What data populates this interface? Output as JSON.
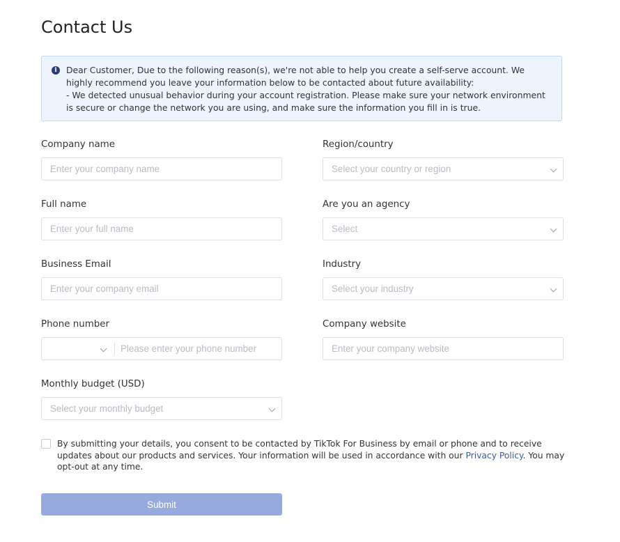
{
  "page": {
    "title": "Contact Us"
  },
  "notice": {
    "line1": "Dear Customer, Due to the following reason(s), we're not able to help you create a self-serve account. We highly recommend you leave your information below to be contacted about future availability:",
    "line2": "- We detected unusual behavior during your account registration. Please make sure your network environment is secure or change the network you are using, and make sure the information you fill in is true."
  },
  "form": {
    "company_name": {
      "label": "Company name",
      "placeholder": "Enter your company name",
      "value": ""
    },
    "region": {
      "label": "Region/country",
      "placeholder": "Select your country or region"
    },
    "full_name": {
      "label": "Full name",
      "placeholder": "Enter your full name",
      "value": ""
    },
    "agency": {
      "label": "Are you an agency",
      "placeholder": "Select"
    },
    "email": {
      "label": "Business Email",
      "placeholder": "Enter your company email",
      "value": ""
    },
    "industry": {
      "label": "Industry",
      "placeholder": "Select your industry"
    },
    "phone": {
      "label": "Phone number",
      "code": "",
      "placeholder": "Please enter your phone number",
      "value": ""
    },
    "website": {
      "label": "Company website",
      "placeholder": "Enter your company website",
      "value": ""
    },
    "budget": {
      "label": "Monthly budget (USD)",
      "placeholder": "Select your monthly budget"
    }
  },
  "consent": {
    "checked": false,
    "text_before": "By submitting your details, you consent to be contacted by TikTok For Business by email or phone and to receive updates about our products and services. Your information will be used in accordance with our ",
    "link": "Privacy Policy",
    "text_after": ". You may opt-out at any time."
  },
  "submit": {
    "label": "Submit"
  },
  "colors": {
    "accent": "#97aadd",
    "link": "#3c5aa8",
    "notice_bg": "#eef4fd",
    "notice_border": "#c6d5ef"
  }
}
